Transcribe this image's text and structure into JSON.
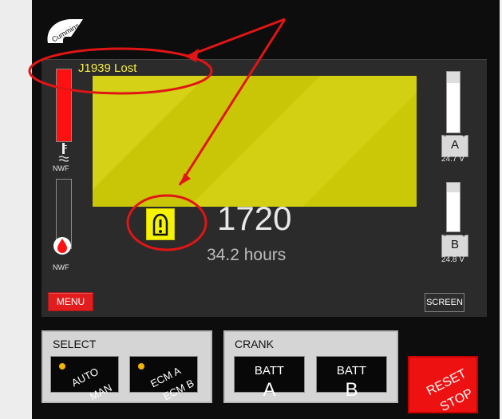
{
  "status": {
    "message": "J1939 Lost"
  },
  "readouts": {
    "rpm": "1720",
    "hours": "34.2 hours"
  },
  "left_gauges": {
    "temp_label": "NWF",
    "oil_label": "NWF"
  },
  "batteries": {
    "a": {
      "letter": "A",
      "plus": "+",
      "minus": "-",
      "voltage": "24.7 V",
      "level": 0.82
    },
    "b": {
      "letter": "B",
      "plus": "+",
      "minus": "-",
      "voltage": "24.8 V",
      "level": 0.8
    }
  },
  "buttons": {
    "menu": "MENU",
    "screen": "SCREEN",
    "reset_top": "RESET",
    "reset_bottom": "STOP"
  },
  "select": {
    "title": "SELECT",
    "auto": "AUTO",
    "man": "MAN",
    "ecm_a": "ECM A",
    "ecm_b": "ECM B"
  },
  "crank": {
    "title": "CRANK",
    "batt_label": "BATT",
    "a": "A",
    "b": "B"
  },
  "colors": {
    "accent_red": "#ff1111",
    "screen_yellow": "#f6f300",
    "warning_yellow": "#f6f300"
  },
  "icons": {
    "logo": "cummins-logo",
    "temperature": "temperature-icon",
    "oil": "oil-drop-icon",
    "warning": "engine-warning-icon"
  }
}
